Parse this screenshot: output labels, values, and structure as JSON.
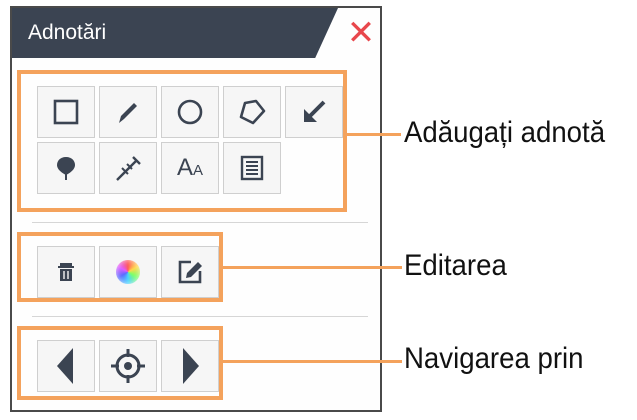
{
  "panel": {
    "title": "Adnotări",
    "close_label": "✕"
  },
  "groups": {
    "add": {
      "tools": [
        {
          "name": "rectangle",
          "icon": "rectangle-icon"
        },
        {
          "name": "pencil",
          "icon": "pencil-icon"
        },
        {
          "name": "circle",
          "icon": "circle-icon"
        },
        {
          "name": "polygon",
          "icon": "polygon-icon"
        },
        {
          "name": "arrow",
          "icon": "arrow-icon"
        },
        {
          "name": "pin",
          "icon": "pin-icon"
        },
        {
          "name": "measure",
          "icon": "measure-icon"
        },
        {
          "name": "text",
          "icon": "text-icon",
          "label_big": "A",
          "label_small": "A"
        },
        {
          "name": "note",
          "icon": "note-icon"
        }
      ]
    },
    "edit": {
      "tools": [
        {
          "name": "delete",
          "icon": "trash-icon"
        },
        {
          "name": "color",
          "icon": "color-wheel-icon"
        },
        {
          "name": "edit",
          "icon": "edit-icon"
        }
      ]
    },
    "nav": {
      "tools": [
        {
          "name": "previous",
          "icon": "triangle-left-icon"
        },
        {
          "name": "locate",
          "icon": "target-icon"
        },
        {
          "name": "next",
          "icon": "triangle-right-icon"
        }
      ]
    }
  },
  "callouts": {
    "add": "Adăugați adnotă",
    "edit": "Editarea",
    "nav": "Navigarea prin"
  },
  "colors": {
    "title_bg": "#3b4452",
    "icon": "#3b4452",
    "highlight": "#f4a25c",
    "close": "#e8474c"
  }
}
